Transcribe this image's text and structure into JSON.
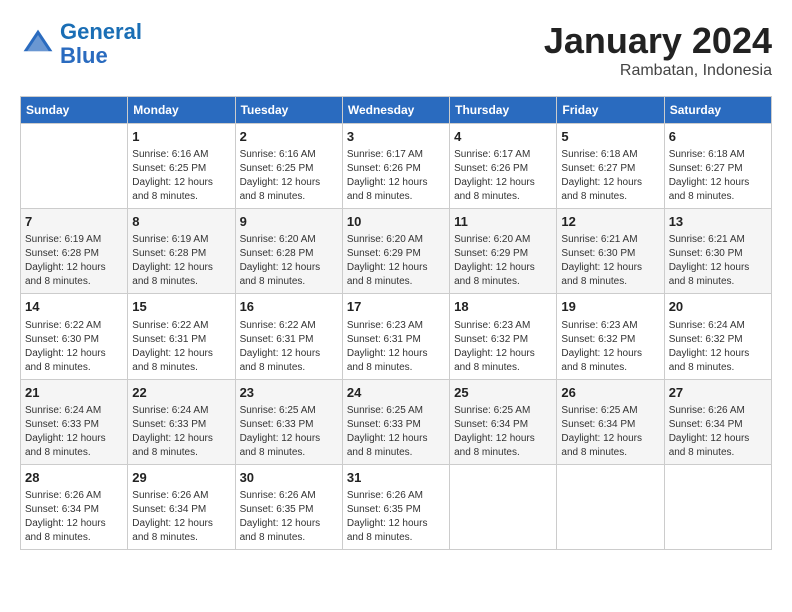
{
  "header": {
    "logo_line1": "General",
    "logo_line2": "Blue",
    "month": "January 2024",
    "location": "Rambatan, Indonesia"
  },
  "days_of_week": [
    "Sunday",
    "Monday",
    "Tuesday",
    "Wednesday",
    "Thursday",
    "Friday",
    "Saturday"
  ],
  "weeks": [
    [
      {
        "day": "",
        "info": ""
      },
      {
        "day": "1",
        "info": "Sunrise: 6:16 AM\nSunset: 6:25 PM\nDaylight: 12 hours\nand 8 minutes."
      },
      {
        "day": "2",
        "info": "Sunrise: 6:16 AM\nSunset: 6:25 PM\nDaylight: 12 hours\nand 8 minutes."
      },
      {
        "day": "3",
        "info": "Sunrise: 6:17 AM\nSunset: 6:26 PM\nDaylight: 12 hours\nand 8 minutes."
      },
      {
        "day": "4",
        "info": "Sunrise: 6:17 AM\nSunset: 6:26 PM\nDaylight: 12 hours\nand 8 minutes."
      },
      {
        "day": "5",
        "info": "Sunrise: 6:18 AM\nSunset: 6:27 PM\nDaylight: 12 hours\nand 8 minutes."
      },
      {
        "day": "6",
        "info": "Sunrise: 6:18 AM\nSunset: 6:27 PM\nDaylight: 12 hours\nand 8 minutes."
      }
    ],
    [
      {
        "day": "7",
        "info": "Sunrise: 6:19 AM\nSunset: 6:28 PM\nDaylight: 12 hours\nand 8 minutes."
      },
      {
        "day": "8",
        "info": "Sunrise: 6:19 AM\nSunset: 6:28 PM\nDaylight: 12 hours\nand 8 minutes."
      },
      {
        "day": "9",
        "info": "Sunrise: 6:20 AM\nSunset: 6:28 PM\nDaylight: 12 hours\nand 8 minutes."
      },
      {
        "day": "10",
        "info": "Sunrise: 6:20 AM\nSunset: 6:29 PM\nDaylight: 12 hours\nand 8 minutes."
      },
      {
        "day": "11",
        "info": "Sunrise: 6:20 AM\nSunset: 6:29 PM\nDaylight: 12 hours\nand 8 minutes."
      },
      {
        "day": "12",
        "info": "Sunrise: 6:21 AM\nSunset: 6:30 PM\nDaylight: 12 hours\nand 8 minutes."
      },
      {
        "day": "13",
        "info": "Sunrise: 6:21 AM\nSunset: 6:30 PM\nDaylight: 12 hours\nand 8 minutes."
      }
    ],
    [
      {
        "day": "14",
        "info": "Sunrise: 6:22 AM\nSunset: 6:30 PM\nDaylight: 12 hours\nand 8 minutes."
      },
      {
        "day": "15",
        "info": "Sunrise: 6:22 AM\nSunset: 6:31 PM\nDaylight: 12 hours\nand 8 minutes."
      },
      {
        "day": "16",
        "info": "Sunrise: 6:22 AM\nSunset: 6:31 PM\nDaylight: 12 hours\nand 8 minutes."
      },
      {
        "day": "17",
        "info": "Sunrise: 6:23 AM\nSunset: 6:31 PM\nDaylight: 12 hours\nand 8 minutes."
      },
      {
        "day": "18",
        "info": "Sunrise: 6:23 AM\nSunset: 6:32 PM\nDaylight: 12 hours\nand 8 minutes."
      },
      {
        "day": "19",
        "info": "Sunrise: 6:23 AM\nSunset: 6:32 PM\nDaylight: 12 hours\nand 8 minutes."
      },
      {
        "day": "20",
        "info": "Sunrise: 6:24 AM\nSunset: 6:32 PM\nDaylight: 12 hours\nand 8 minutes."
      }
    ],
    [
      {
        "day": "21",
        "info": "Sunrise: 6:24 AM\nSunset: 6:33 PM\nDaylight: 12 hours\nand 8 minutes."
      },
      {
        "day": "22",
        "info": "Sunrise: 6:24 AM\nSunset: 6:33 PM\nDaylight: 12 hours\nand 8 minutes."
      },
      {
        "day": "23",
        "info": "Sunrise: 6:25 AM\nSunset: 6:33 PM\nDaylight: 12 hours\nand 8 minutes."
      },
      {
        "day": "24",
        "info": "Sunrise: 6:25 AM\nSunset: 6:33 PM\nDaylight: 12 hours\nand 8 minutes."
      },
      {
        "day": "25",
        "info": "Sunrise: 6:25 AM\nSunset: 6:34 PM\nDaylight: 12 hours\nand 8 minutes."
      },
      {
        "day": "26",
        "info": "Sunrise: 6:25 AM\nSunset: 6:34 PM\nDaylight: 12 hours\nand 8 minutes."
      },
      {
        "day": "27",
        "info": "Sunrise: 6:26 AM\nSunset: 6:34 PM\nDaylight: 12 hours\nand 8 minutes."
      }
    ],
    [
      {
        "day": "28",
        "info": "Sunrise: 6:26 AM\nSunset: 6:34 PM\nDaylight: 12 hours\nand 8 minutes."
      },
      {
        "day": "29",
        "info": "Sunrise: 6:26 AM\nSunset: 6:34 PM\nDaylight: 12 hours\nand 8 minutes."
      },
      {
        "day": "30",
        "info": "Sunrise: 6:26 AM\nSunset: 6:35 PM\nDaylight: 12 hours\nand 8 minutes."
      },
      {
        "day": "31",
        "info": "Sunrise: 6:26 AM\nSunset: 6:35 PM\nDaylight: 12 hours\nand 8 minutes."
      },
      {
        "day": "",
        "info": ""
      },
      {
        "day": "",
        "info": ""
      },
      {
        "day": "",
        "info": ""
      }
    ]
  ]
}
